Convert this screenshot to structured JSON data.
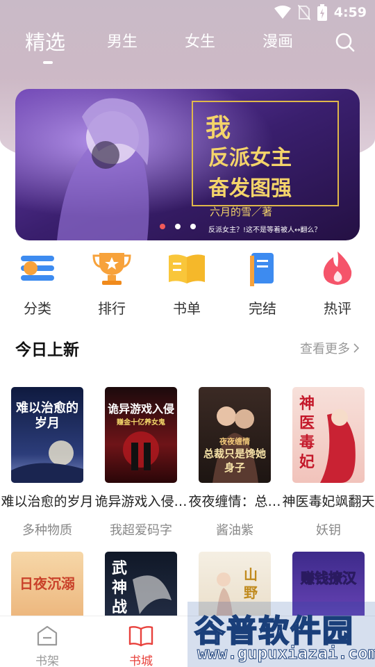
{
  "status_bar": {
    "time": "4:59"
  },
  "tabs": [
    {
      "label": "精选",
      "active": true
    },
    {
      "label": "男生",
      "active": false
    },
    {
      "label": "女生",
      "active": false
    },
    {
      "label": "漫画",
      "active": false
    }
  ],
  "banner": {
    "title_lines": [
      "我",
      "反派女主",
      "奋发图强"
    ],
    "author": "六月的雪／著",
    "tagline": "反派女主？!这不是等着被人↔翻么？",
    "slide_index": 1,
    "slide_count": 3
  },
  "quick_entries": [
    {
      "label": "分类",
      "icon": "category-icon"
    },
    {
      "label": "排行",
      "icon": "trophy-icon"
    },
    {
      "label": "书单",
      "icon": "booklist-icon"
    },
    {
      "label": "完结",
      "icon": "finished-icon"
    },
    {
      "label": "热评",
      "icon": "flame-icon"
    }
  ],
  "section": {
    "title": "今日上新",
    "more": "查看更多"
  },
  "books_row1": [
    {
      "title": "难以治愈的岁月",
      "author": "多种物质",
      "cover_text": "难以治愈的岁月",
      "cover_color": "#1f2e5e"
    },
    {
      "title": "诡异游戏入侵…",
      "author": "我超爱码字",
      "cover_text": "诡异游戏入侵",
      "cover_sub": "赚金十亿养女鬼",
      "cover_color": "#3a0d12"
    },
    {
      "title": "夜夜缠情：总…",
      "author": "酱油紫",
      "cover_text": "总裁只是馋她身子",
      "cover_sub": "夜夜缠情",
      "cover_color": "#2b2220"
    },
    {
      "title": "神医毒妃飒翻天",
      "author": "妖钥",
      "cover_text": "神医毒妃",
      "cover_color": "#f3d4cf"
    }
  ],
  "books_row2": [
    {
      "cover_text": "日夜沉溺",
      "cover_color": "#f2c38b"
    },
    {
      "cover_text": "武神战",
      "cover_color": "#1b2236"
    },
    {
      "cover_text": "山野",
      "cover_color": "#efe6d7"
    },
    {
      "cover_text": "赚钱撩汉",
      "cover_color": "#5a3aa0"
    }
  ],
  "bottom_nav": [
    {
      "label": "书架",
      "active": false
    },
    {
      "label": "书城",
      "active": true
    }
  ],
  "watermark": {
    "text": "谷普软件园",
    "url": "www.gupuxiazai.com"
  },
  "colors": {
    "accent": "#e8413c",
    "tab_text": "#ffffff",
    "gray_text": "#888888"
  }
}
